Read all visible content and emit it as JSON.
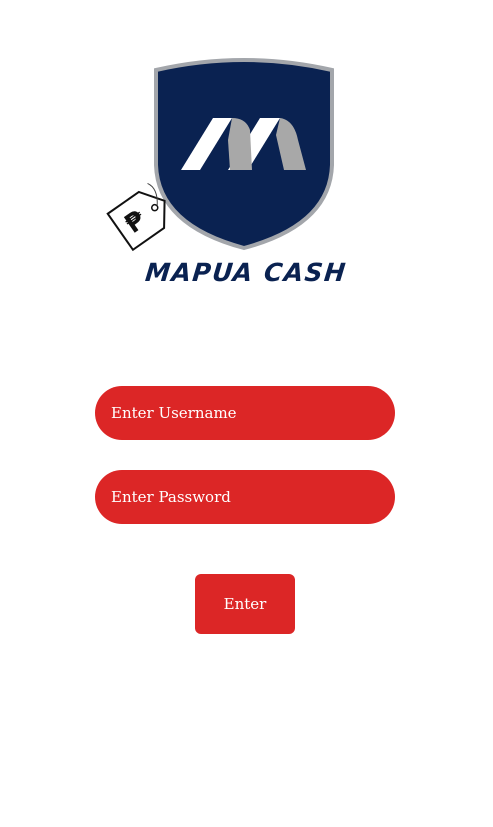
{
  "logo": {
    "brand_text": "MAPUA CASH",
    "icons": [
      "shield-logo-icon",
      "peso-tag-icon"
    ],
    "colors": {
      "shield_fill": "#0a2251",
      "shield_border": "#a3a6ab",
      "stripe_light": "#ffffff",
      "stripe_gray": "#a8a8a8"
    }
  },
  "login": {
    "username_placeholder": "Enter Username",
    "password_placeholder": "Enter Password",
    "enter_label": "Enter",
    "accent_color": "#dc2626"
  }
}
